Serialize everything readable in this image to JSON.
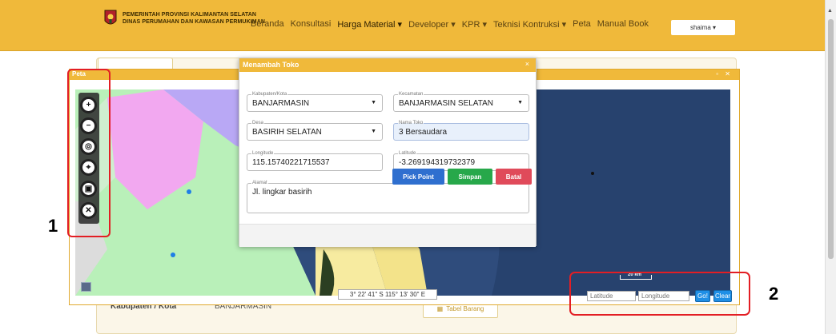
{
  "header": {
    "brand_line1": "PEMERINTAH PROVINSI KALIMANTAN SELATAN",
    "brand_line2": "DINAS PERUMAHAN DAN KAWASAN PERMUKIMAN",
    "nav": [
      "Beranda",
      "Konsultasi",
      "Harga Material ▾",
      "Developer ▾",
      "KPR ▾",
      "Teknisi Kontruksi ▾",
      "Peta",
      "Manual Book"
    ],
    "user": "shaima ▾"
  },
  "background": {
    "kab_label": "Kabupaten / Kota",
    "kab_value": "BANJARMASIN",
    "tabel_button": "Tabel Barang"
  },
  "peta": {
    "title": "Peta",
    "window_controls": "▫ ✕",
    "coord_readout": "3° 22' 41\" S 115° 13' 30\" E",
    "scale_label": "20 km",
    "lat_placeholder": "Latitude",
    "lon_placeholder": "Longitude",
    "go_label": "Go!",
    "clear_label": "Clear",
    "tools": [
      "zoom-in",
      "zoom-out",
      "globe",
      "locate",
      "layers",
      "settings"
    ]
  },
  "modal": {
    "title": "Menambah Toko",
    "close": "×",
    "kabupaten": {
      "label": "Kabupaten/Kota",
      "value": "BANJARMASIN"
    },
    "kecamatan": {
      "label": "Kecamatan",
      "value": "BANJARMASIN SELATAN"
    },
    "desa": {
      "label": "Desa",
      "value": "BASIRIH SELATAN"
    },
    "nama_toko": {
      "label": "Nama Toko",
      "value": "3 Bersaudara"
    },
    "longitude": {
      "label": "Longitude",
      "value": "115.15740221715537"
    },
    "latitude": {
      "label": "Latitude",
      "value": "-3.269194319732379"
    },
    "alamat": {
      "label": "Alamat",
      "value": "Jl. lingkar basirih"
    },
    "buttons": {
      "pick": "Pick Point",
      "save": "Simpan",
      "cancel": "Batal"
    }
  },
  "annotations": {
    "one": "1",
    "two": "2"
  },
  "colors": {
    "brand": "#f0b93a",
    "primary": "#2f6fcf",
    "success": "#27a84a",
    "danger": "#e04a5a",
    "annotation": "#e31e24"
  }
}
